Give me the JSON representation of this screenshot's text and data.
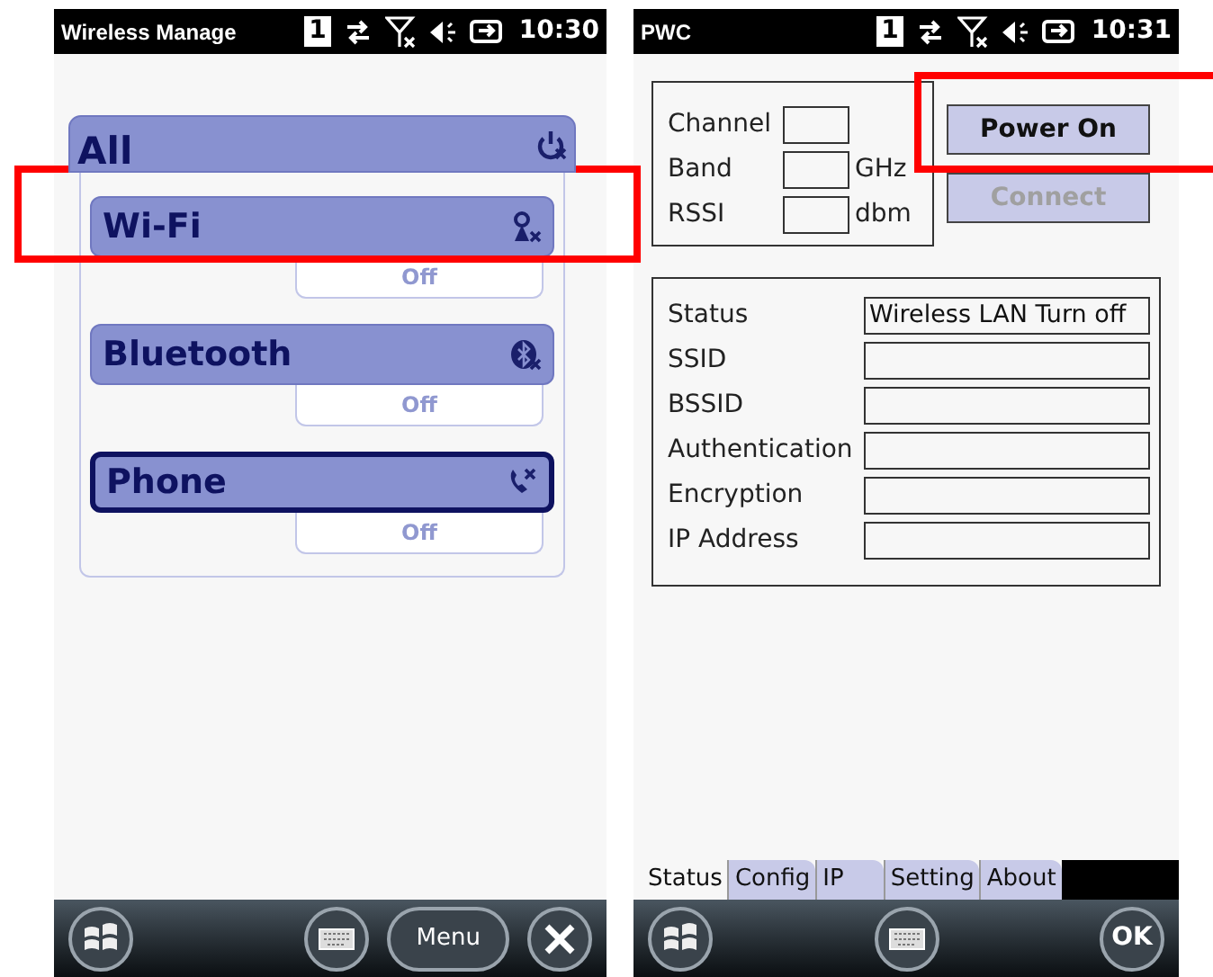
{
  "left_screen": {
    "status_bar": {
      "title": "Wireless Manage",
      "badge": "1",
      "time": "10:30"
    },
    "group": {
      "label": "All",
      "kind": "power",
      "items": [
        {
          "label": "Wi-Fi",
          "kind": "wifi",
          "state": "Off",
          "selected": false
        },
        {
          "label": "Bluetooth",
          "kind": "bluetooth",
          "state": "Off",
          "selected": false
        },
        {
          "label": "Phone",
          "kind": "phone",
          "state": "Off",
          "selected": true
        }
      ]
    },
    "bottom_bar": {
      "menu": "Menu"
    }
  },
  "right_screen": {
    "status_bar": {
      "title": "PWC",
      "badge": "1",
      "time": "10:31"
    },
    "radio_fields": [
      {
        "label": "Channel"
      },
      {
        "label": "Band",
        "unit": "GHz"
      },
      {
        "label": "RSSI",
        "unit": "dbm"
      }
    ],
    "buttons": [
      {
        "label": "Power On",
        "disabled": false
      },
      {
        "label": "Connect",
        "disabled": true
      }
    ],
    "status_fields": [
      {
        "label": "Status",
        "value": "Wireless LAN Turn off"
      },
      {
        "label": "SSID"
      },
      {
        "label": "BSSID"
      },
      {
        "label": "Authentication"
      },
      {
        "label": "Encryption"
      },
      {
        "label": "IP Address"
      }
    ],
    "tabs": [
      {
        "label": "Status",
        "selected": true
      },
      {
        "label": "Config",
        "selected": false
      },
      {
        "label": "IP",
        "selected": false
      },
      {
        "label": "Setting",
        "selected": false
      },
      {
        "label": "About",
        "selected": false
      }
    ],
    "bottom_bar": {
      "ok": "OK"
    }
  }
}
